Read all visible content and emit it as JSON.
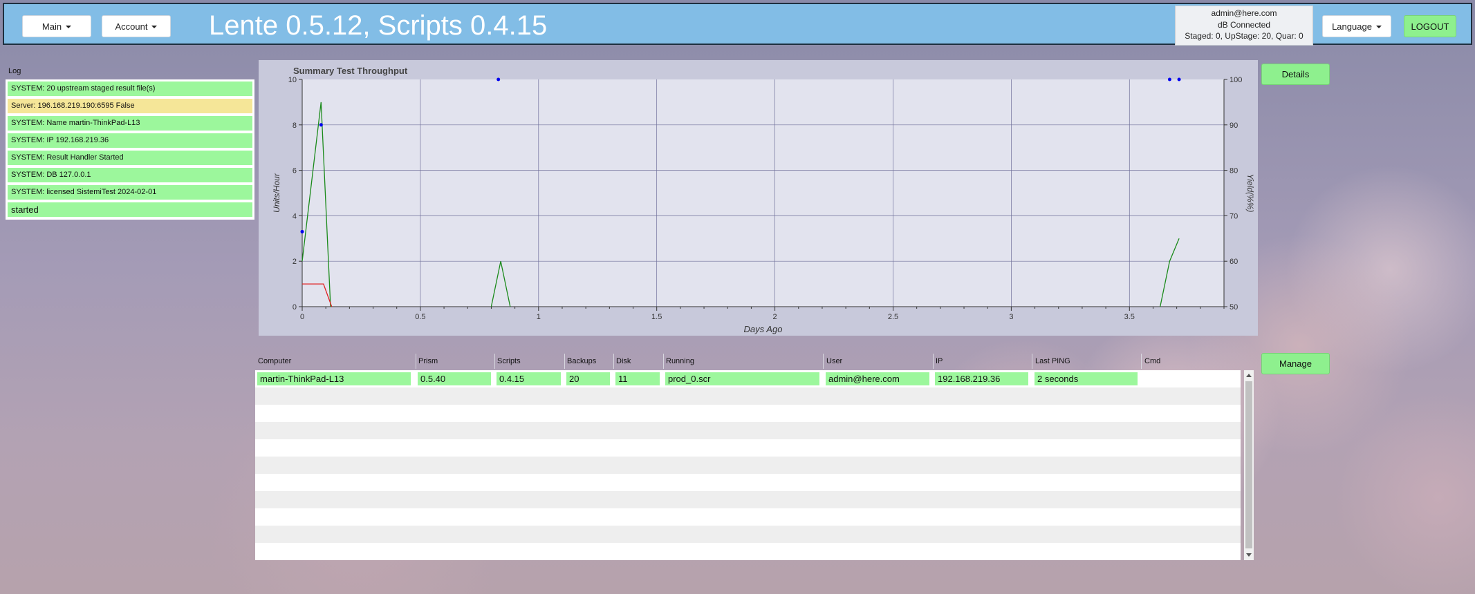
{
  "header": {
    "main_menu": "Main",
    "account_menu": "Account",
    "title": "Lente 0.5.12, Scripts 0.4.15",
    "status_lines": [
      "admin@here.com",
      "dB Connected",
      "Staged: 0, UpStage: 20, Quar: 0"
    ],
    "language_menu": "Language",
    "logout": "LOGOUT",
    "colors": {
      "bar": "#82bde6",
      "button_green": "#8ef08e"
    }
  },
  "log": {
    "title": "Log",
    "entries": [
      {
        "text": "SYSTEM: 20 upstream staged result file(s)",
        "status": "ok"
      },
      {
        "text": "Server: 196.168.219.190:6595 False",
        "status": "warn"
      },
      {
        "text": "SYSTEM: Name martin-ThinkPad-L13",
        "status": "ok"
      },
      {
        "text": "SYSTEM: IP 192.168.219.36",
        "status": "ok"
      },
      {
        "text": "SYSTEM: Result Handler Started",
        "status": "ok"
      },
      {
        "text": "SYSTEM: DB 127.0.0.1",
        "status": "ok"
      },
      {
        "text": "SYSTEM: licensed SistemiTest 2024-02-01",
        "status": "ok"
      },
      {
        "text": "started",
        "status": "ok"
      }
    ]
  },
  "chart_data": {
    "type": "line",
    "title": "Summary Test Throughput",
    "xlabel": "Days Ago",
    "ylabel": "Units/Hour",
    "y2label": "Yield(%%)",
    "xlim": [
      0,
      3.9
    ],
    "ylim": [
      0,
      10
    ],
    "y2lim": [
      50,
      100
    ],
    "xticks": [
      0,
      0.5,
      1,
      1.5,
      2,
      2.5,
      3,
      3.5
    ],
    "yticks": [
      0,
      2,
      4,
      6,
      8,
      10
    ],
    "y2ticks": [
      50,
      60,
      70,
      80,
      90,
      100
    ],
    "grid": true,
    "series": [
      {
        "color": "#1a8a1a",
        "axis": "left",
        "kind": "line",
        "x": [
          0,
          0.08,
          0.12,
          null,
          0.8,
          0.84,
          0.88,
          null,
          3.63,
          3.67,
          3.71
        ],
        "y": [
          2,
          9,
          0,
          null,
          0,
          2,
          0,
          null,
          0,
          2,
          3
        ]
      },
      {
        "color": "#e02020",
        "axis": "left",
        "kind": "line",
        "x": [
          0,
          0.09,
          0.125
        ],
        "y": [
          1,
          1,
          0
        ]
      },
      {
        "color": "#0000ee",
        "axis": "right",
        "kind": "points",
        "x": [
          0,
          0.08,
          0.83,
          3.67,
          3.71
        ],
        "y": [
          66.5,
          90,
          100,
          100,
          100
        ]
      }
    ]
  },
  "buttons": {
    "details": "Details",
    "manage": "Manage"
  },
  "table": {
    "columns": [
      "Computer",
      "Prism",
      "Scripts",
      "Backups",
      "Disk",
      "Running",
      "User",
      "IP",
      "Last PING",
      "Cmd"
    ],
    "rows": [
      [
        "martin-ThinkPad-L13",
        "0.5.40",
        "0.4.15",
        "20",
        "11",
        "prod_0.scr",
        "admin@here.com",
        "192.168.219.36",
        "2 seconds",
        ""
      ]
    ]
  }
}
